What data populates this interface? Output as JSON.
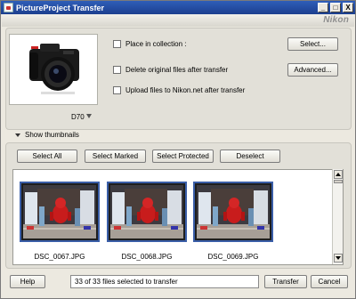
{
  "window": {
    "title": "PictureProject Transfer",
    "brand": "Nikon",
    "buttons": {
      "minimize": "_",
      "maximize": "□",
      "close": "X"
    }
  },
  "camera": {
    "model": "D70"
  },
  "options": [
    {
      "label": "Place in collection :",
      "checked": false,
      "button": "Select..."
    },
    {
      "label": "Delete original files after transfer",
      "checked": false,
      "button": "Advanced..."
    },
    {
      "label": "Upload files to Nikon.net after transfer",
      "checked": false,
      "button": ""
    }
  ],
  "thumbnails_toggle": "Show thumbnails",
  "toolbar": {
    "select_all": "Select All",
    "select_marked": "Select Marked",
    "select_protected": "Select Protected",
    "deselect": "Deselect"
  },
  "thumbnails": [
    {
      "filename": "DSC_0067.JPG"
    },
    {
      "filename": "DSC_0068.JPG"
    },
    {
      "filename": "DSC_0069.JPG"
    }
  ],
  "footer": {
    "help": "Help",
    "status": "33 of 33 files selected to transfer",
    "transfer": "Transfer",
    "cancel": "Cancel"
  }
}
